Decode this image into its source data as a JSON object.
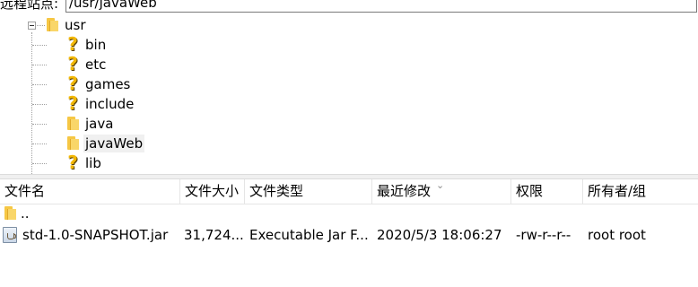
{
  "remote_site": {
    "label": "远程站点:",
    "path": "/usr/javaWeb"
  },
  "tree": {
    "root": {
      "label": "usr",
      "icon": "folder-icon"
    },
    "children": [
      {
        "label": "bin",
        "icon": "question-mark-icon"
      },
      {
        "label": "etc",
        "icon": "question-mark-icon"
      },
      {
        "label": "games",
        "icon": "question-mark-icon"
      },
      {
        "label": "include",
        "icon": "question-mark-icon"
      },
      {
        "label": "java",
        "icon": "folder-icon"
      },
      {
        "label": "javaWeb",
        "icon": "folder-icon",
        "selected": true
      },
      {
        "label": "lib",
        "icon": "question-mark-icon"
      }
    ]
  },
  "file_list": {
    "columns": [
      "文件名",
      "文件大小",
      "文件类型",
      "最近修改",
      "权限",
      "所有者/组"
    ],
    "sorted_column": "最近修改",
    "parent_row": {
      "name": ".."
    },
    "files": [
      {
        "name": "std-1.0-SNAPSHOT.jar",
        "size": "31,724...",
        "type": "Executable Jar F...",
        "modified": "2020/5/3 18:06:27",
        "permissions": "-rw-r--r--",
        "owner": "root root",
        "icon": "jar-file-icon"
      }
    ]
  }
}
